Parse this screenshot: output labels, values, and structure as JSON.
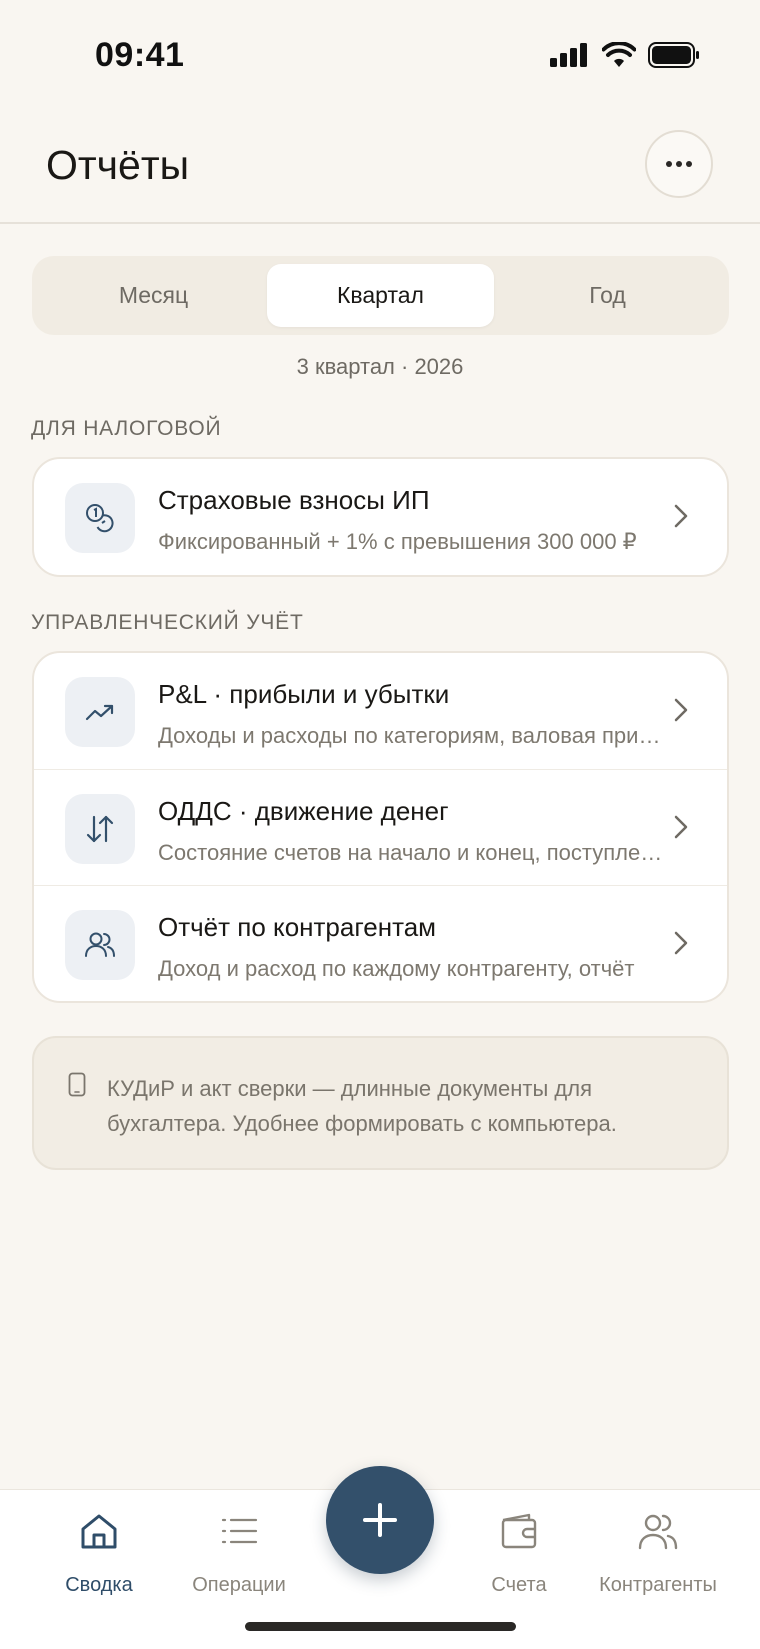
{
  "status_bar": {
    "time": "09:41"
  },
  "header": {
    "title": "Отчёты"
  },
  "period_tabs": [
    {
      "label": "Месяц",
      "active": false
    },
    {
      "label": "Квартал",
      "active": true
    },
    {
      "label": "Год",
      "active": false
    }
  ],
  "period_label": "3 квартал · 2026",
  "sections": [
    {
      "label": "ДЛЯ НАЛОГОВОЙ",
      "items": [
        {
          "icon": "coins-icon",
          "title": "Страховые взносы ИП",
          "subtitle": "Фиксированный + 1% с превышения 300 000 ₽"
        }
      ]
    },
    {
      "label": "УПРАВЛЕНЧЕСКИЙ УЧЁТ",
      "items": [
        {
          "icon": "trend-up-icon",
          "title": "P&L · прибыли и убытки",
          "subtitle": "Доходы и расходы по категориям, валовая прибыль"
        },
        {
          "icon": "arrows-up-down-icon",
          "title": "ОДДС · движение денег",
          "subtitle": "Состояние счетов на начало и конец, поступления"
        },
        {
          "icon": "users-icon",
          "title": "Отчёт по контрагентам",
          "subtitle": "Доход и расход по каждому контрагенту, отчёт"
        }
      ]
    }
  ],
  "note": {
    "icon": "phone-icon",
    "text": "КУДиР и акт сверки — длинные документы для бухгалтера. Удобнее формировать с компьютера."
  },
  "tabbar": [
    {
      "icon": "home-icon",
      "label": "Сводка",
      "active": true
    },
    {
      "icon": "list-icon",
      "label": "Операции",
      "active": false
    },
    {
      "icon": "wallet-icon",
      "label": "Счета",
      "active": false
    },
    {
      "icon": "users-icon",
      "label": "Контрагенты",
      "active": false
    }
  ],
  "colors": {
    "accent": "#33506b",
    "background": "#f9f6f1",
    "card": "#ffffff"
  }
}
